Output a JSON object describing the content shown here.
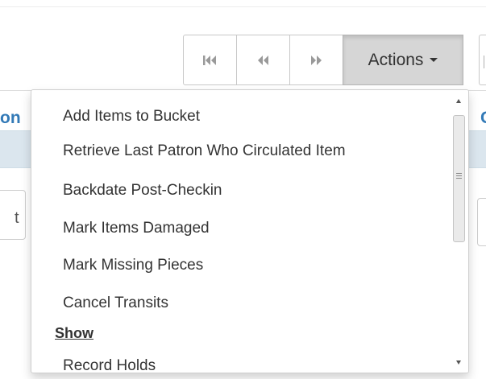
{
  "toolbar": {
    "first_icon": "first-page-icon",
    "prev_icon": "previous-page-icon",
    "next_icon": "next-page-icon",
    "actions_label": "Actions",
    "caret_icon": "caret-down-icon"
  },
  "grid": {
    "left_header_fragment": "on",
    "right_header_fragment": "C",
    "left_filter_fragment": "t"
  },
  "menu": {
    "items": [
      "Add Items to Bucket",
      "Retrieve Last Patron Who Circulated Item",
      "Backdate Post-Checkin",
      "Mark Items Damaged",
      "Mark Missing Pieces",
      "Cancel Transits"
    ],
    "section_header": "Show",
    "section_items": [
      "Record Holds"
    ]
  },
  "colors": {
    "accent": "#337ab7",
    "active_button": "#d6d6d6",
    "row_band": "#dbe6ee"
  }
}
